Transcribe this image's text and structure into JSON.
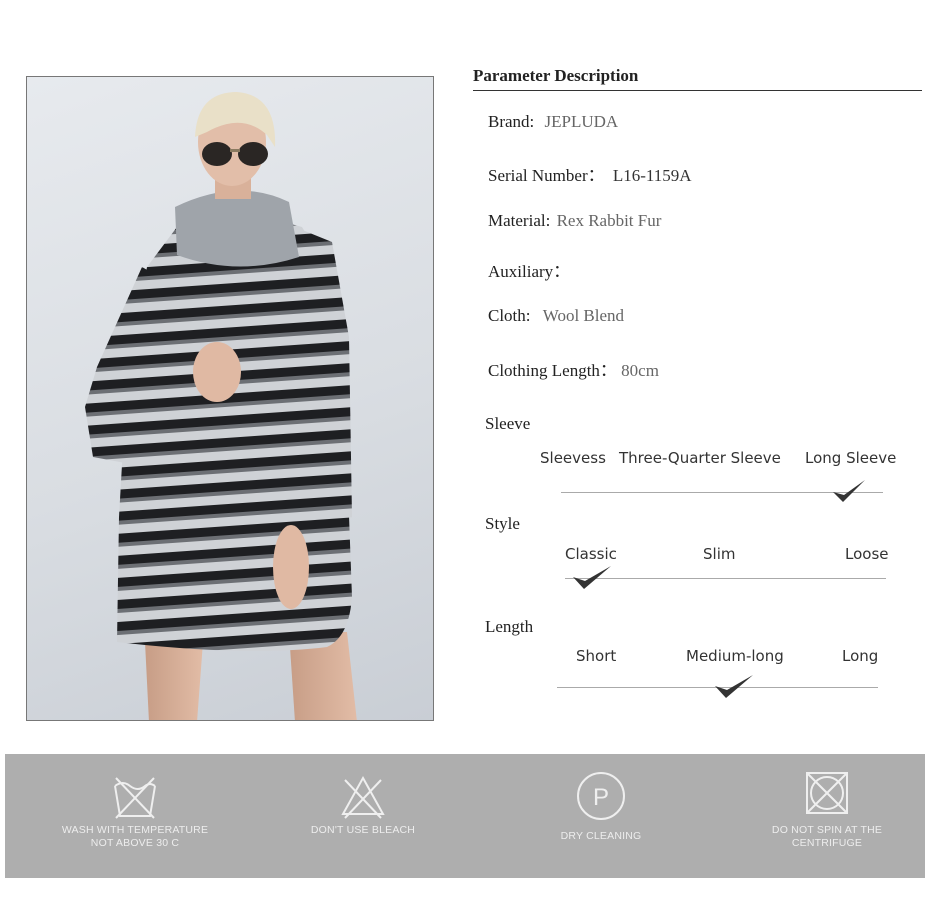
{
  "param": {
    "title": "Parameter Description",
    "rows": [
      {
        "label": "Brand:",
        "value": "JEPLUDA"
      },
      {
        "label": "Serial Number：",
        "value": "L16-1159A"
      },
      {
        "label": "Material:",
        "value": "Rex Rabbit Fur"
      },
      {
        "label": "Auxiliary：",
        "value": ""
      },
      {
        "label": "Cloth:",
        "value": "Wool Blend"
      },
      {
        "label": "Clothing Length：",
        "value": "80cm"
      }
    ]
  },
  "sleeve": {
    "title": "Sleeve",
    "options": [
      "Sleevess",
      "Three-Quarter Sleeve",
      "Long Sleeve"
    ],
    "selected": "Long Sleeve"
  },
  "style": {
    "title": "Style",
    "options": [
      "Classic",
      "Slim",
      "Loose"
    ],
    "selected": "Classic"
  },
  "length": {
    "title": "Length",
    "options": [
      "Short",
      "Medium-long",
      "Long"
    ],
    "selected": "Medium-long"
  },
  "care": [
    {
      "icon": "wash-temperature-icon",
      "label1": "WASH WITH TEMPERATURE",
      "label2": "NOT ABOVE 30 C"
    },
    {
      "icon": "no-bleach-icon",
      "label1": "DON'T USE BLEACH",
      "label2": ""
    },
    {
      "icon": "dry-cleaning-icon",
      "label1": "DRY CLEANING",
      "label2": "",
      "glyph": "P"
    },
    {
      "icon": "no-spin-icon",
      "label1": "DO NOT SPIN AT THE",
      "label2": "CENTRIFUGE"
    }
  ],
  "colors": {
    "care_band": "#aeaeae",
    "rule": "#333333",
    "value_text": "#666666"
  }
}
